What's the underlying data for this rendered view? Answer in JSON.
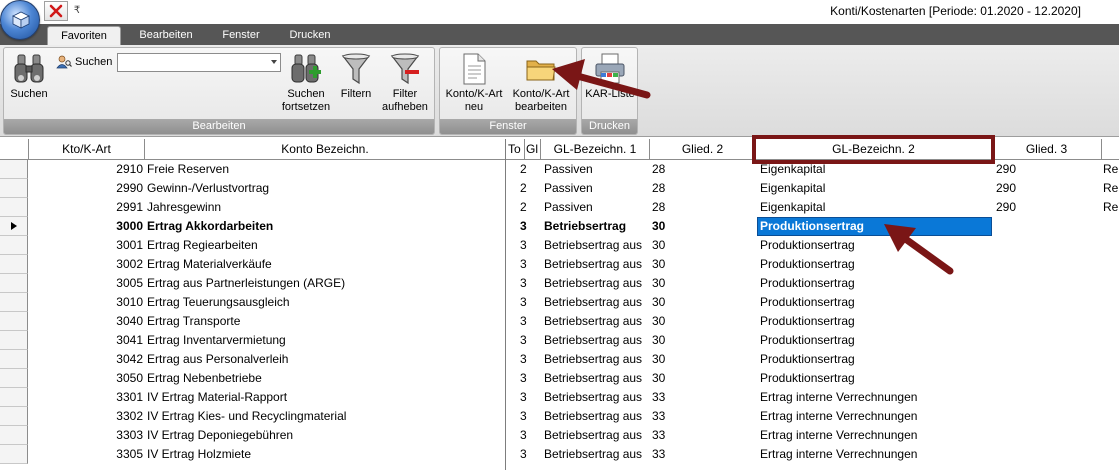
{
  "window": {
    "title": "Konti/Kostenarten  [Periode: 01.2020 - 12.2020]"
  },
  "quick_access": {
    "dropdown_glyph": "₹"
  },
  "tabs": [
    {
      "label": "Favoriten",
      "active": true
    },
    {
      "label": "Bearbeiten",
      "active": false
    },
    {
      "label": "Fenster",
      "active": false
    },
    {
      "label": "Drucken",
      "active": false
    }
  ],
  "ribbon": {
    "groups": {
      "bearbeiten": "Bearbeiten",
      "fenster": "Fenster",
      "drucken": "Drucken"
    },
    "search": {
      "label": "Suchen",
      "value": ""
    },
    "buttons": {
      "suchen": "Suchen",
      "suchen_fortsetzen": "Suchen\nfortsetzen",
      "filtern": "Filtern",
      "filter_aufheben": "Filter\naufheben",
      "konto_neu": "Konto/K-Art\nneu",
      "konto_bearbeiten": "Konto/K-Art\nbearbeiten",
      "kar_liste": "KAR-Liste"
    }
  },
  "grid": {
    "headers": {
      "kto": "Kto/K-Art",
      "bezeichnung": "Konto Bezeichn.",
      "to": "To",
      "gl": "Gl",
      "gl_bez_1": "GL-Bezeichn. 1",
      "glied_2": "Glied. 2",
      "gl_bez_2": "GL-Bezeichn. 2",
      "glied_3": "Glied. 3"
    },
    "rows": [
      {
        "kto": "2910",
        "bez": "Freie Reserven",
        "to": "2",
        "gl1": "Passiven",
        "g2": "28",
        "gl2": "Eigenkapital",
        "g3": "290",
        "gl3": "Re",
        "bold": false,
        "current": false,
        "selected": false
      },
      {
        "kto": "2990",
        "bez": "Gewinn-/Verlustvortrag",
        "to": "2",
        "gl1": "Passiven",
        "g2": "28",
        "gl2": "Eigenkapital",
        "g3": "290",
        "gl3": "Re",
        "bold": false,
        "current": false,
        "selected": false
      },
      {
        "kto": "2991",
        "bez": "Jahresgewinn",
        "to": "2",
        "gl1": "Passiven",
        "g2": "28",
        "gl2": "Eigenkapital",
        "g3": "290",
        "gl3": "Re",
        "bold": false,
        "current": false,
        "selected": false
      },
      {
        "kto": "3000",
        "bez": "Ertrag Akkordarbeiten",
        "to": "3",
        "gl1": "Betriebsertrag",
        "g2": "30",
        "gl2": "Produktionsertrag",
        "g3": "",
        "gl3": "",
        "bold": true,
        "current": true,
        "selected": true
      },
      {
        "kto": "3001",
        "bez": "Ertrag Regiearbeiten",
        "to": "3",
        "gl1": "Betriebsertrag aus",
        "g2": "30",
        "gl2": "Produktionsertrag",
        "g3": "",
        "gl3": "",
        "bold": false,
        "current": false,
        "selected": false
      },
      {
        "kto": "3002",
        "bez": "Ertrag Materialverkäufe",
        "to": "3",
        "gl1": "Betriebsertrag aus",
        "g2": "30",
        "gl2": "Produktionsertrag",
        "g3": "",
        "gl3": "",
        "bold": false,
        "current": false,
        "selected": false
      },
      {
        "kto": "3005",
        "bez": "Ertrag aus Partnerleistungen (ARGE)",
        "to": "3",
        "gl1": "Betriebsertrag aus",
        "g2": "30",
        "gl2": "Produktionsertrag",
        "g3": "",
        "gl3": "",
        "bold": false,
        "current": false,
        "selected": false
      },
      {
        "kto": "3010",
        "bez": "Ertrag Teuerungsausgleich",
        "to": "3",
        "gl1": "Betriebsertrag aus",
        "g2": "30",
        "gl2": "Produktionsertrag",
        "g3": "",
        "gl3": "",
        "bold": false,
        "current": false,
        "selected": false
      },
      {
        "kto": "3040",
        "bez": "Ertrag Transporte",
        "to": "3",
        "gl1": "Betriebsertrag aus",
        "g2": "30",
        "gl2": "Produktionsertrag",
        "g3": "",
        "gl3": "",
        "bold": false,
        "current": false,
        "selected": false
      },
      {
        "kto": "3041",
        "bez": "Ertrag Inventarvermietung",
        "to": "3",
        "gl1": "Betriebsertrag aus",
        "g2": "30",
        "gl2": "Produktionsertrag",
        "g3": "",
        "gl3": "",
        "bold": false,
        "current": false,
        "selected": false
      },
      {
        "kto": "3042",
        "bez": "Ertrag aus Personalverleih",
        "to": "3",
        "gl1": "Betriebsertrag aus",
        "g2": "30",
        "gl2": "Produktionsertrag",
        "g3": "",
        "gl3": "",
        "bold": false,
        "current": false,
        "selected": false
      },
      {
        "kto": "3050",
        "bez": "Ertrag Nebenbetriebe",
        "to": "3",
        "gl1": "Betriebsertrag aus",
        "g2": "30",
        "gl2": "Produktionsertrag",
        "g3": "",
        "gl3": "",
        "bold": false,
        "current": false,
        "selected": false
      },
      {
        "kto": "3301",
        "bez": "IV Ertrag Material-Rapport",
        "to": "3",
        "gl1": "Betriebsertrag aus",
        "g2": "33",
        "gl2": "Ertrag interne Verrechnungen",
        "g3": "",
        "gl3": "",
        "bold": false,
        "current": false,
        "selected": false
      },
      {
        "kto": "3302",
        "bez": "IV Ertrag Kies- und Recyclingmaterial",
        "to": "3",
        "gl1": "Betriebsertrag aus",
        "g2": "33",
        "gl2": "Ertrag interne Verrechnungen",
        "g3": "",
        "gl3": "",
        "bold": false,
        "current": false,
        "selected": false
      },
      {
        "kto": "3303",
        "bez": "IV Ertrag Deponiegebühren",
        "to": "3",
        "gl1": "Betriebsertrag aus",
        "g2": "33",
        "gl2": "Ertrag interne Verrechnungen",
        "g3": "",
        "gl3": "",
        "bold": false,
        "current": false,
        "selected": false
      },
      {
        "kto": "3305",
        "bez": "IV Ertrag Holzmiete",
        "to": "3",
        "gl1": "Betriebsertrag aus",
        "g2": "33",
        "gl2": "Ertrag interne Verrechnungen",
        "g3": "",
        "gl3": "",
        "bold": false,
        "current": false,
        "selected": false
      }
    ]
  },
  "colors": {
    "annotation": "#7a1616",
    "selection": "#0a78d7",
    "tab_bar": "#565656",
    "group_label": "#999999"
  }
}
